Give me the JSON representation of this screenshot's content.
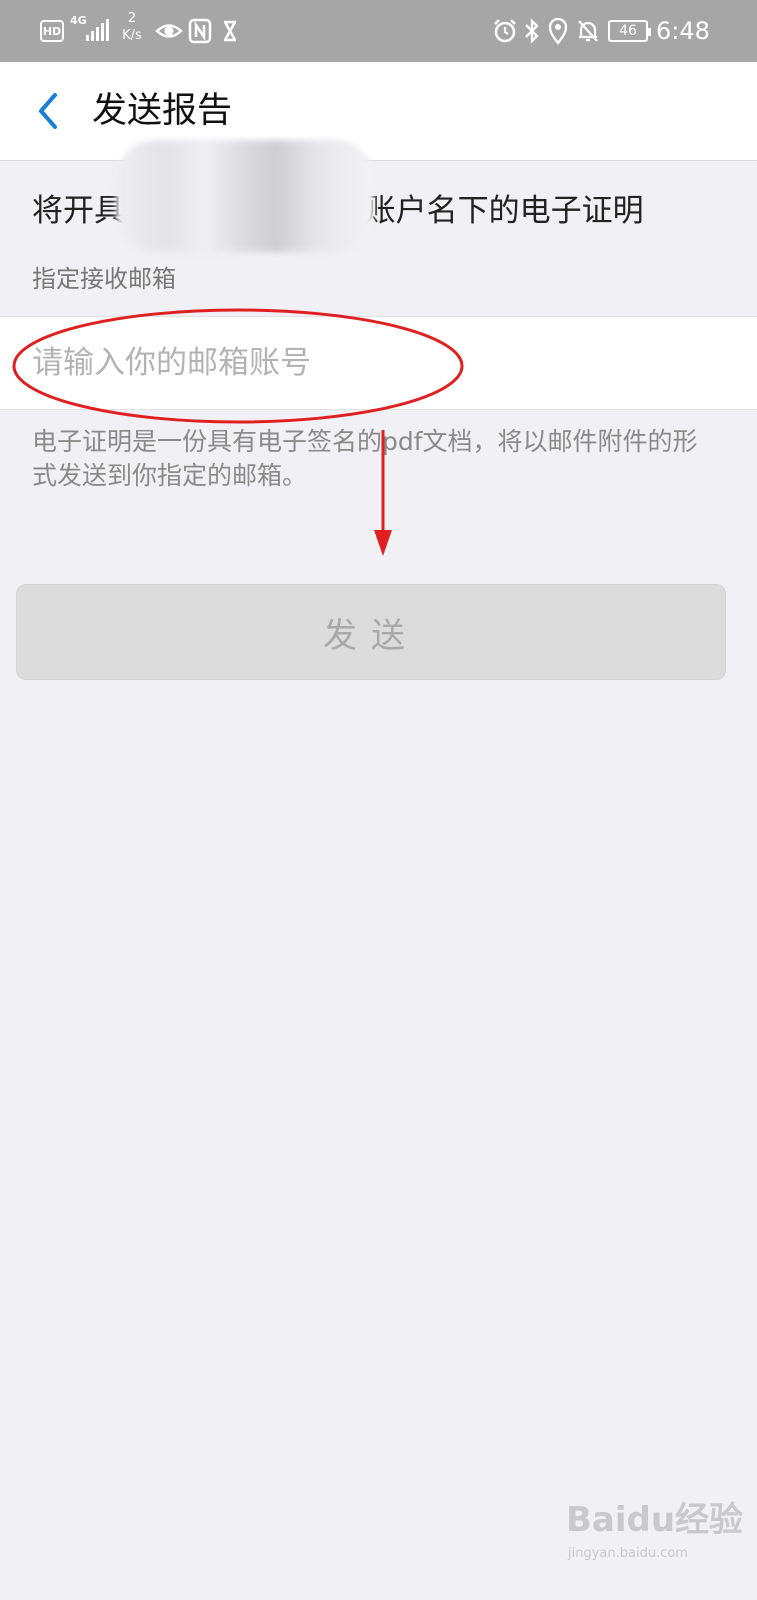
{
  "status_bar": {
    "hd": "HD",
    "network": "4G",
    "speed_value": "2",
    "speed_unit": "K/s",
    "battery": "46",
    "time": "6:48"
  },
  "nav": {
    "title": "发送报告"
  },
  "main": {
    "description": "将开具",
    "description_tail": "n账户名下的电子证明",
    "section_label": "指定接收邮箱",
    "email_placeholder": "请输入你的邮箱账号",
    "hint": "电子证明是一份具有电子签名的pdf文档，将以邮件附件的形式发送到你指定的邮箱。",
    "send_label": "发送",
    "send_state": "disabled"
  },
  "annotation": {
    "color": "#e02020"
  },
  "watermark": {
    "brand": "Baidu经验",
    "url": "jingyan.baidu.com"
  },
  "colors": {
    "status_bar_bg": "#a6a6a6",
    "accent_blue": "#1a7fd6",
    "page_bg": "#f1f1f5"
  }
}
